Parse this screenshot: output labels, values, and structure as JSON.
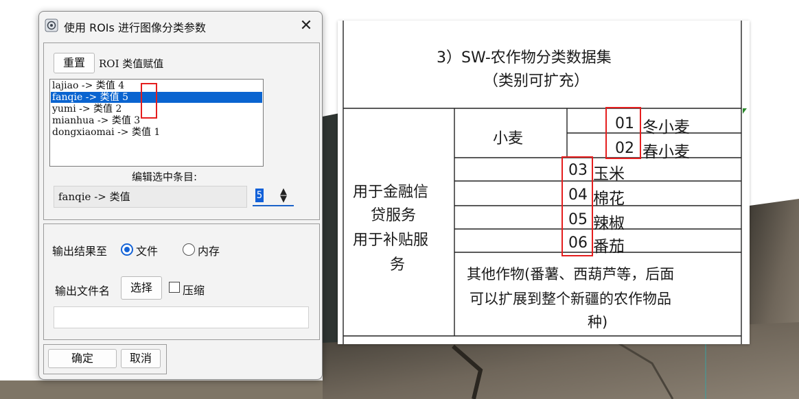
{
  "dialog": {
    "title": "使用 ROIs 进行图像分类参数",
    "close_glyph": "✕",
    "reset_label": "重置",
    "roi_label_prefix": "ROI",
    "roi_label_suffix": " 类值赋值",
    "roi_items": [
      {
        "text": "lajiao -> 类值 4",
        "selected": false
      },
      {
        "text": "fanqie -> 类值 5",
        "selected": true
      },
      {
        "text": "yumi -> 类值 2",
        "selected": false
      },
      {
        "text": "mianhua -> 类值 3",
        "selected": false
      },
      {
        "text": "dongxiaomai -> 类值 1",
        "selected": false
      }
    ],
    "edit_label": "编辑选中条目:",
    "edit_value": "fanqie -> 类值",
    "spinner_value": "5",
    "output_label": "输出结果至",
    "radio_file": "文件",
    "radio_memory": "内存",
    "file_name_label": "输出文件名",
    "choose_label": "选择",
    "compress_label": "压缩",
    "output_path": "",
    "ok_label": "确定",
    "cancel_label": "取消"
  },
  "table": {
    "heading": "3）SW-农作物分类数据集",
    "subheading": "（类别可扩充）",
    "group_label_line1": "用于金融信",
    "group_label_line2": "贷服务",
    "group_label_line3": "用于补贴服",
    "group_label_line4": "务",
    "wheat_label": "小麦",
    "rows": [
      {
        "code": "01",
        "name": "冬小麦"
      },
      {
        "code": "02",
        "name": "春小麦"
      },
      {
        "code": "03",
        "name": "玉米"
      },
      {
        "code": "04",
        "name": "棉花"
      },
      {
        "code": "05",
        "name": "辣椒"
      },
      {
        "code": "06",
        "name": "番茄"
      }
    ],
    "other_line1": "其他作物(番薯、西葫芦等，后面",
    "other_line2": "可以扩展到整个新疆的农作物品",
    "other_line3": "种)"
  },
  "colors": {
    "highlight_red": "#e51d1d",
    "selection_blue": "#0a64d0",
    "accent_blue": "#1463d6"
  }
}
